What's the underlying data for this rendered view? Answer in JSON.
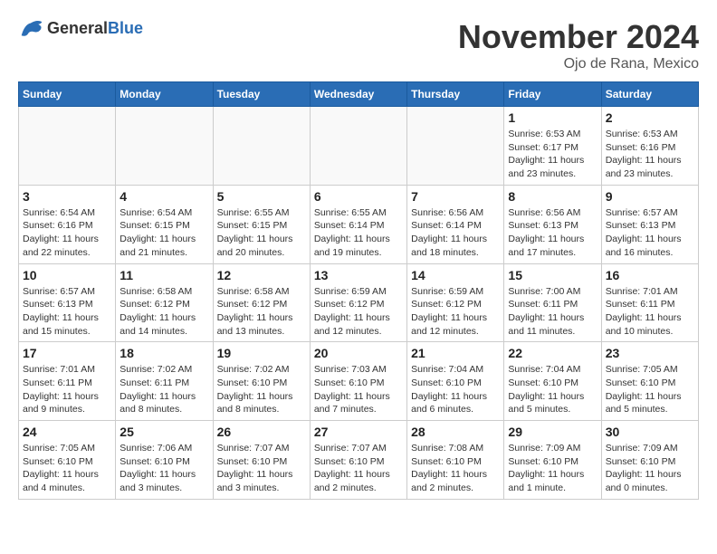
{
  "header": {
    "logo_general": "General",
    "logo_blue": "Blue",
    "month": "November 2024",
    "location": "Ojo de Rana, Mexico"
  },
  "days_of_week": [
    "Sunday",
    "Monday",
    "Tuesday",
    "Wednesday",
    "Thursday",
    "Friday",
    "Saturday"
  ],
  "weeks": [
    [
      {
        "day": "",
        "info": ""
      },
      {
        "day": "",
        "info": ""
      },
      {
        "day": "",
        "info": ""
      },
      {
        "day": "",
        "info": ""
      },
      {
        "day": "",
        "info": ""
      },
      {
        "day": "1",
        "info": "Sunrise: 6:53 AM\nSunset: 6:17 PM\nDaylight: 11 hours and 23 minutes."
      },
      {
        "day": "2",
        "info": "Sunrise: 6:53 AM\nSunset: 6:16 PM\nDaylight: 11 hours and 23 minutes."
      }
    ],
    [
      {
        "day": "3",
        "info": "Sunrise: 6:54 AM\nSunset: 6:16 PM\nDaylight: 11 hours and 22 minutes."
      },
      {
        "day": "4",
        "info": "Sunrise: 6:54 AM\nSunset: 6:15 PM\nDaylight: 11 hours and 21 minutes."
      },
      {
        "day": "5",
        "info": "Sunrise: 6:55 AM\nSunset: 6:15 PM\nDaylight: 11 hours and 20 minutes."
      },
      {
        "day": "6",
        "info": "Sunrise: 6:55 AM\nSunset: 6:14 PM\nDaylight: 11 hours and 19 minutes."
      },
      {
        "day": "7",
        "info": "Sunrise: 6:56 AM\nSunset: 6:14 PM\nDaylight: 11 hours and 18 minutes."
      },
      {
        "day": "8",
        "info": "Sunrise: 6:56 AM\nSunset: 6:13 PM\nDaylight: 11 hours and 17 minutes."
      },
      {
        "day": "9",
        "info": "Sunrise: 6:57 AM\nSunset: 6:13 PM\nDaylight: 11 hours and 16 minutes."
      }
    ],
    [
      {
        "day": "10",
        "info": "Sunrise: 6:57 AM\nSunset: 6:13 PM\nDaylight: 11 hours and 15 minutes."
      },
      {
        "day": "11",
        "info": "Sunrise: 6:58 AM\nSunset: 6:12 PM\nDaylight: 11 hours and 14 minutes."
      },
      {
        "day": "12",
        "info": "Sunrise: 6:58 AM\nSunset: 6:12 PM\nDaylight: 11 hours and 13 minutes."
      },
      {
        "day": "13",
        "info": "Sunrise: 6:59 AM\nSunset: 6:12 PM\nDaylight: 11 hours and 12 minutes."
      },
      {
        "day": "14",
        "info": "Sunrise: 6:59 AM\nSunset: 6:12 PM\nDaylight: 11 hours and 12 minutes."
      },
      {
        "day": "15",
        "info": "Sunrise: 7:00 AM\nSunset: 6:11 PM\nDaylight: 11 hours and 11 minutes."
      },
      {
        "day": "16",
        "info": "Sunrise: 7:01 AM\nSunset: 6:11 PM\nDaylight: 11 hours and 10 minutes."
      }
    ],
    [
      {
        "day": "17",
        "info": "Sunrise: 7:01 AM\nSunset: 6:11 PM\nDaylight: 11 hours and 9 minutes."
      },
      {
        "day": "18",
        "info": "Sunrise: 7:02 AM\nSunset: 6:11 PM\nDaylight: 11 hours and 8 minutes."
      },
      {
        "day": "19",
        "info": "Sunrise: 7:02 AM\nSunset: 6:10 PM\nDaylight: 11 hours and 8 minutes."
      },
      {
        "day": "20",
        "info": "Sunrise: 7:03 AM\nSunset: 6:10 PM\nDaylight: 11 hours and 7 minutes."
      },
      {
        "day": "21",
        "info": "Sunrise: 7:04 AM\nSunset: 6:10 PM\nDaylight: 11 hours and 6 minutes."
      },
      {
        "day": "22",
        "info": "Sunrise: 7:04 AM\nSunset: 6:10 PM\nDaylight: 11 hours and 5 minutes."
      },
      {
        "day": "23",
        "info": "Sunrise: 7:05 AM\nSunset: 6:10 PM\nDaylight: 11 hours and 5 minutes."
      }
    ],
    [
      {
        "day": "24",
        "info": "Sunrise: 7:05 AM\nSunset: 6:10 PM\nDaylight: 11 hours and 4 minutes."
      },
      {
        "day": "25",
        "info": "Sunrise: 7:06 AM\nSunset: 6:10 PM\nDaylight: 11 hours and 3 minutes."
      },
      {
        "day": "26",
        "info": "Sunrise: 7:07 AM\nSunset: 6:10 PM\nDaylight: 11 hours and 3 minutes."
      },
      {
        "day": "27",
        "info": "Sunrise: 7:07 AM\nSunset: 6:10 PM\nDaylight: 11 hours and 2 minutes."
      },
      {
        "day": "28",
        "info": "Sunrise: 7:08 AM\nSunset: 6:10 PM\nDaylight: 11 hours and 2 minutes."
      },
      {
        "day": "29",
        "info": "Sunrise: 7:09 AM\nSunset: 6:10 PM\nDaylight: 11 hours and 1 minute."
      },
      {
        "day": "30",
        "info": "Sunrise: 7:09 AM\nSunset: 6:10 PM\nDaylight: 11 hours and 0 minutes."
      }
    ]
  ]
}
